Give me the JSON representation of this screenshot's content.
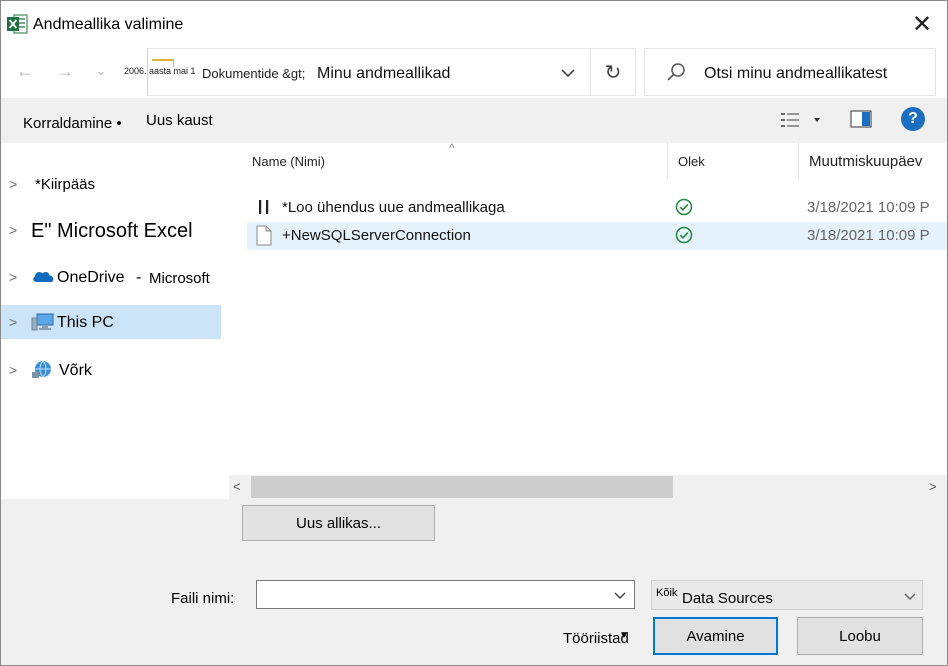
{
  "window": {
    "title": "Andmeallika valimine",
    "close_glyph": "✕"
  },
  "nav": {
    "back_glyph": "←",
    "forward_glyph": "→",
    "recent_glyph": "⌄",
    "breadcrumb_small": "2006. aasta mai 1",
    "breadcrumb_mid": "Dokumentide &gt;",
    "breadcrumb_current": "Minu andmeallikad",
    "refresh_glyph": "↻",
    "search_placeholder": "Otsi minu andmeallikatest"
  },
  "toolbar": {
    "organize_label": "Korraldamine •",
    "new_folder_label": "Uus kaust",
    "help_glyph": "?"
  },
  "sidebar": {
    "items": [
      {
        "label": "*Kiirpääs",
        "chevron": ">",
        "icon": ""
      },
      {
        "label": "E\" Microsoft Excel",
        "chevron": ">",
        "icon": ""
      },
      {
        "label": "OneDrive",
        "sub": "Microsoft",
        "sep": "-",
        "chevron": ">",
        "icon": "onedrive-icon"
      },
      {
        "label": "This PC",
        "chevron": ">",
        "icon": "this-pc-icon",
        "selected": true
      },
      {
        "label": "Võrk",
        "chevron": ">",
        "icon": "network-icon"
      }
    ]
  },
  "columns": {
    "name": "Name (Nimi)",
    "status": "Olek",
    "modified": "Muutmiskuupäev",
    "sort_glyph": "^"
  },
  "files": [
    {
      "name": "*Loo ühendus uue andmeallikaga",
      "status": "synced",
      "date": "3/18/2021 10:09 P",
      "icon": "pause-icon"
    },
    {
      "name": "+NewSQLServerConnection",
      "status": "synced",
      "date": "3/18/2021 10:09 P",
      "icon": "file-icon",
      "selected": true
    }
  ],
  "scrollbar": {
    "left_glyph": "<",
    "right_glyph": ">"
  },
  "bottom": {
    "new_source_label": "Uus allikas...",
    "filename_label": "Faili nimi:",
    "filename_value": "",
    "filetype_prefix": "Kõik",
    "filetype_label": "Data Sources",
    "tools_label": "Tööriistad",
    "open_label": "Avamine",
    "cancel_label": "Loobu"
  },
  "colors": {
    "accent": "#0078d7",
    "selected_nav": "#cce4f7",
    "selected_row": "#e5f1fb",
    "status_green": "#1e8a3c",
    "excel_green": "#1d6f42",
    "help_blue": "#1a6fc1"
  }
}
